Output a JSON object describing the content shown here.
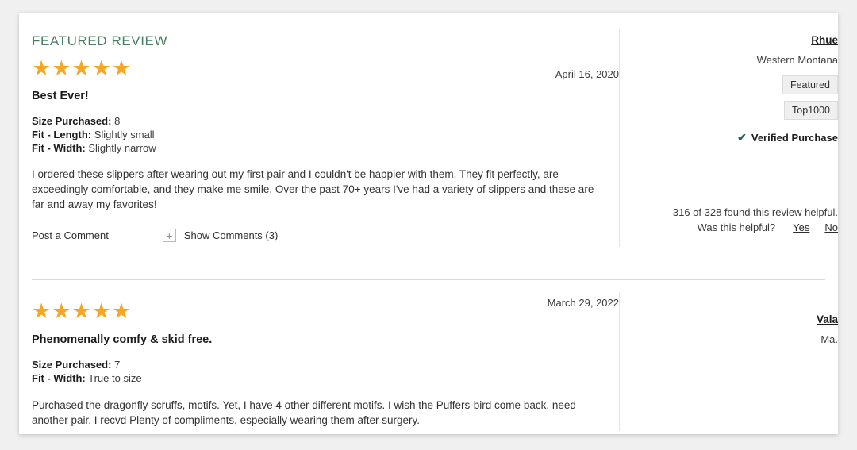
{
  "card": {
    "featured_label": "FEATURED REVIEW",
    "stars_glyph": "★★★★★"
  },
  "reviews": [
    {
      "featured_heading": "FEATURED REVIEW",
      "rating_stars": "★★★★★",
      "rating_value": 5,
      "date": "April 16, 2020",
      "title": "Best Ever!",
      "attributes": [
        {
          "key": "Size Purchased:",
          "value": "8"
        },
        {
          "key": "Fit - Length:",
          "value": "Slightly small"
        },
        {
          "key": "Fit - Width:",
          "value": "Slightly narrow"
        }
      ],
      "body": "I ordered these slippers after wearing out my first pair and I couldn't be happier with them. They fit perfectly, are exceedingly comfortable, and they make me smile. Over the past 70+ years I've had a variety of slippers and these are far and away my favorites!",
      "post_comment_label": "Post a Comment",
      "expand_icon_glyph": "+",
      "show_comments_label": "Show Comments (3)",
      "reviewer": "Rhue",
      "location": "Western Montana",
      "badges": [
        "Featured",
        "Top1000"
      ],
      "verified_label": "Verified Purchase",
      "verified_check_glyph": "✔",
      "helpful_count_text": "316 of 328 found this review helpful.",
      "helpful_question": "Was this helpful?",
      "vote_yes": "Yes",
      "vote_no": "No"
    },
    {
      "rating_stars": "★★★★★",
      "rating_value": 5,
      "date": "March 29, 2022",
      "title": "Phenomenally comfy & skid free.",
      "attributes": [
        {
          "key": "Size Purchased:",
          "value": "7"
        },
        {
          "key": "Fit - Width:",
          "value": "True to size"
        }
      ],
      "body": "Purchased the dragonfly scruffs, motifs. Yet, I have 4 other different motifs. I wish the Puffers-bird come back, need another pair. I recvd Plenty of compliments, especially wearing them after surgery.",
      "reviewer": "Vala",
      "location": "Ma."
    }
  ],
  "colors": {
    "page_background": "#f0f0f0",
    "card_background": "#ffffff",
    "featured_heading": "#4c7c64",
    "star": "#f5a623",
    "verified_check": "#1d6b45",
    "badge_background": "#efefef",
    "divider": "#d8d8d8"
  }
}
